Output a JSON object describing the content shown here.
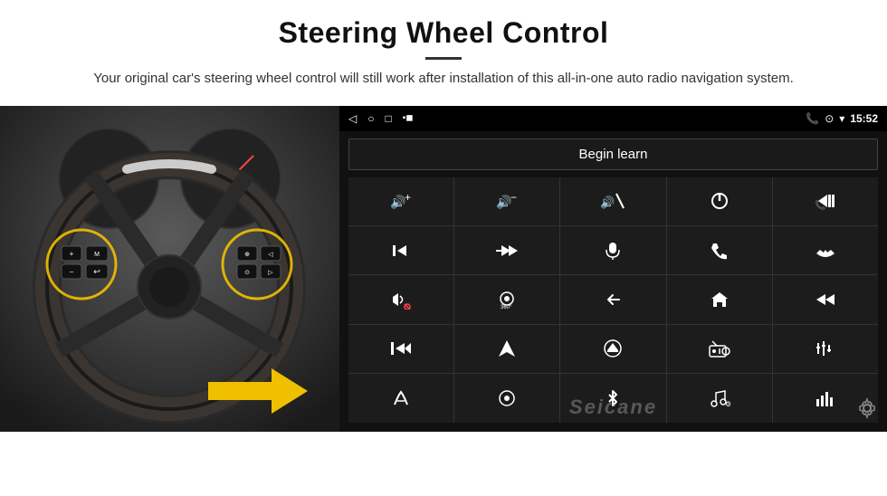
{
  "header": {
    "title": "Steering Wheel Control",
    "subtitle": "Your original car's steering wheel control will still work after installation of this all-in-one auto radio navigation system."
  },
  "status_bar": {
    "time": "15:52",
    "back_icon": "◁",
    "home_icon": "○",
    "recents_icon": "□",
    "battery_icon": "▪◼",
    "phone_icon": "📞",
    "location_icon": "⊙",
    "wifi_icon": "▾"
  },
  "begin_learn": {
    "label": "Begin learn"
  },
  "controls": [
    {
      "icon": "🔊+",
      "name": "vol-up"
    },
    {
      "icon": "🔊−",
      "name": "vol-down"
    },
    {
      "icon": "🔇",
      "name": "mute"
    },
    {
      "icon": "⏻",
      "name": "power"
    },
    {
      "icon": "⏮",
      "name": "prev-track"
    },
    {
      "icon": "⏭",
      "name": "next"
    },
    {
      "icon": "⏩",
      "name": "fast-forward"
    },
    {
      "icon": "🎤",
      "name": "mic"
    },
    {
      "icon": "📞",
      "name": "call"
    },
    {
      "icon": "↩",
      "name": "hang-up"
    },
    {
      "icon": "🔔",
      "name": "sound-mode"
    },
    {
      "icon": "360°",
      "name": "camera-360"
    },
    {
      "icon": "↩",
      "name": "back"
    },
    {
      "icon": "🏠",
      "name": "home"
    },
    {
      "icon": "⏮⏮",
      "name": "rewind"
    },
    {
      "icon": "⏭⏭",
      "name": "skip-forward"
    },
    {
      "icon": "▶",
      "name": "play"
    },
    {
      "icon": "⊖",
      "name": "eject"
    },
    {
      "icon": "📻",
      "name": "radio"
    },
    {
      "icon": "⚙",
      "name": "eq"
    },
    {
      "icon": "🎤",
      "name": "voice"
    },
    {
      "icon": "⊙",
      "name": "menu"
    },
    {
      "icon": "✱",
      "name": "bluetooth"
    },
    {
      "icon": "🎵",
      "name": "music"
    },
    {
      "icon": "📊",
      "name": "spectrum"
    }
  ],
  "watermark": "Seicane",
  "settings_icon": "⚙"
}
